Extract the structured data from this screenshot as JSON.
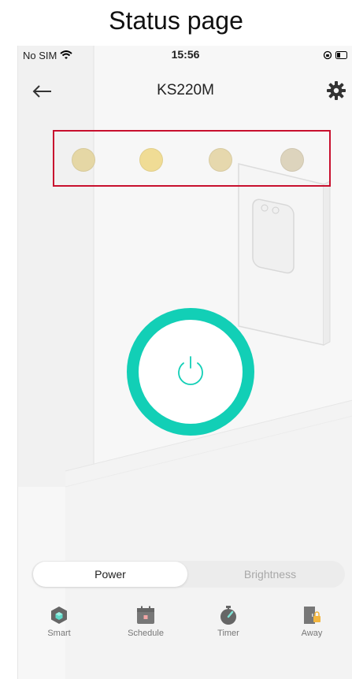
{
  "caption": "Status page",
  "status_bar": {
    "carrier": "No SIM",
    "time": "15:56"
  },
  "header": {
    "title": "KS220M"
  },
  "leds": {
    "colors": [
      "#e5d7a5",
      "#f0dc95",
      "#e6d8ad",
      "#ddd4bd"
    ]
  },
  "colors": {
    "accent": "#12cfb6",
    "highlight_border": "#c8102e"
  },
  "segment": {
    "power_label": "Power",
    "brightness_label": "Brightness",
    "selected": "Power"
  },
  "tabbar": {
    "items": [
      {
        "label": "Smart",
        "icon": "cube-icon"
      },
      {
        "label": "Schedule",
        "icon": "calendar-icon"
      },
      {
        "label": "Timer",
        "icon": "stopwatch-icon"
      },
      {
        "label": "Away",
        "icon": "door-lock-icon"
      }
    ]
  }
}
